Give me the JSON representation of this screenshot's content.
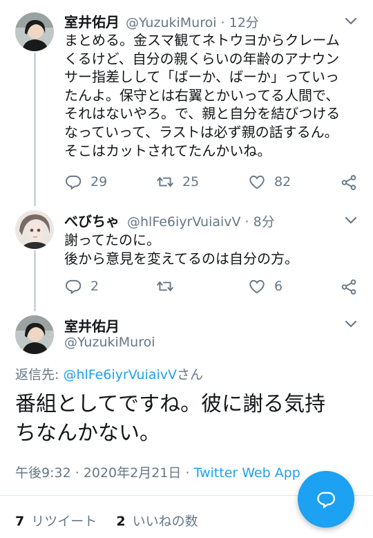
{
  "colors": {
    "accent": "#1da1f2",
    "secondary_text": "#657786",
    "primary_text": "#14171a",
    "thread_line": "#ccd6dd"
  },
  "tweets": [
    {
      "name": "室井佑月",
      "handle": "@YuzukiMuroi · 12分",
      "text": "まとめる。金スマ観てネトウヨからクレーム\nくるけど、自分の親くらいの年齢のアナウン\nサー指差しして「ばーか、ばーか」っていっ\nたんよ。保守とは右翼とかいってる人間で、\nそれはないやろ。で、親と自分を結びつける\nなっていって、ラストは必ず親の話するん。\nそこはカットされてたんかいね。",
      "replies": "29",
      "retweets": "25",
      "likes": "82"
    },
    {
      "name": "べびちゃ",
      "handle": "@hlFe6iyrVuiaivV · 8分",
      "text": "謝ってたのに。\n後から意見を変えてるのは自分の方。",
      "replies": "2",
      "retweets": "",
      "likes": "6"
    }
  ],
  "main_tweet": {
    "name": "室井佑月",
    "handle": "@YuzukiMuroi",
    "reply_prefix": "返信先: ",
    "reply_to": "@hlFe6iyrVuiaivV",
    "reply_suffix": "さん",
    "text": "番組としてですね。彼に謝る気持\nちなんかない。",
    "timestamp": "午後9:32 · 2020年2月21日 · ",
    "source": "Twitter Web App",
    "retweet_count": "7",
    "retweet_label": "リツイート",
    "like_count": "2",
    "like_label": "いいねの数"
  },
  "icons": [
    "reply-icon",
    "retweet-icon",
    "like-icon",
    "share-icon",
    "chevron-down-icon",
    "compose-reply-icon"
  ]
}
